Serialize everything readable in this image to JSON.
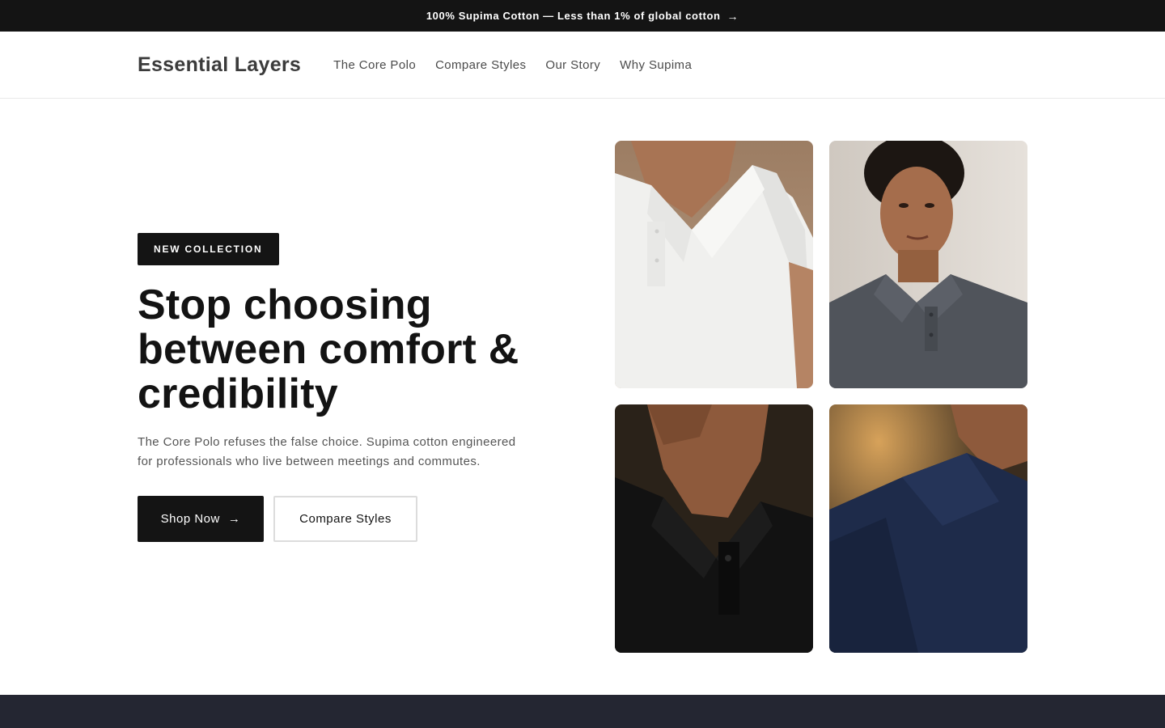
{
  "announcement": {
    "text": "100% Supima Cotton — Less than 1% of global cotton",
    "arrow": "→"
  },
  "header": {
    "logo": "Essential Layers",
    "nav": [
      {
        "label": "The Core Polo"
      },
      {
        "label": "Compare Styles"
      },
      {
        "label": "Our Story"
      },
      {
        "label": "Why Supima"
      }
    ]
  },
  "hero": {
    "badge": "NEW COLLECTION",
    "headline_lines": [
      "Stop choosing",
      "between comfort &",
      "credibility"
    ],
    "subcopy": "The Core Polo refuses the false choice. Supima cotton engineered for professionals who live between meetings and commutes.",
    "primary_cta": "Shop Now",
    "primary_cta_arrow": "→",
    "secondary_cta": "Compare Styles"
  },
  "gallery": {
    "images": [
      {
        "name": "white-polo-image",
        "color": "#eeeeec"
      },
      {
        "name": "grey-polo-image",
        "color": "#4d5158"
      },
      {
        "name": "black-polo-image",
        "color": "#121212"
      },
      {
        "name": "navy-polo-image",
        "color": "#1d2a48"
      }
    ]
  },
  "colors": {
    "dark": "#141414",
    "footer_band": "#242632",
    "text_muted": "#555555"
  }
}
